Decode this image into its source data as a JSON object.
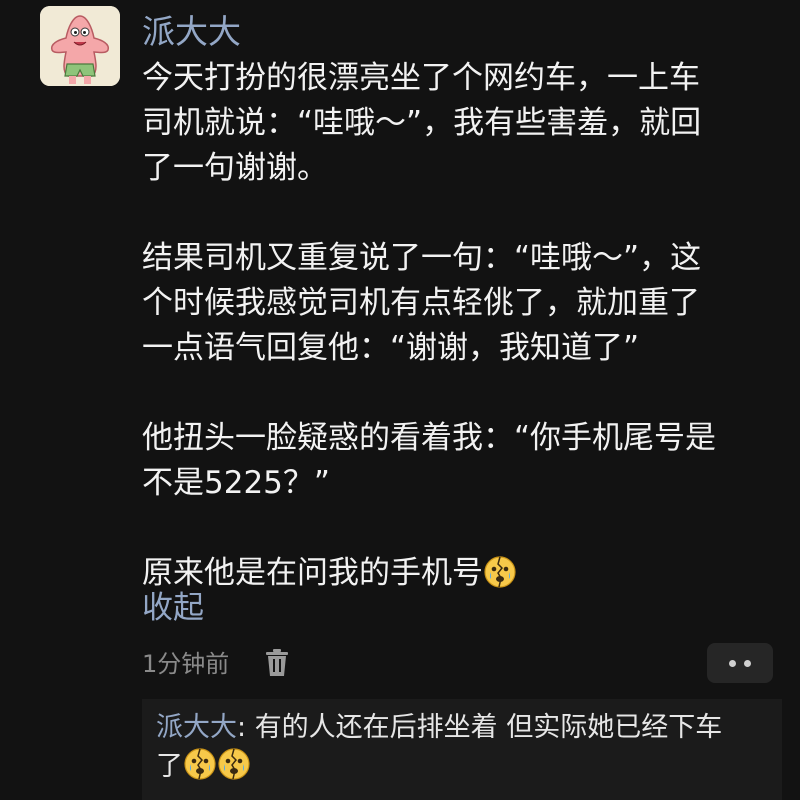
{
  "comment": {
    "author": "派大大",
    "lines": [
      "今天打扮的很漂亮坐了个网约车，一上车",
      "司机就说：“哇哦～”，我有些害羞，就回",
      "了一句谢谢。",
      "",
      "结果司机又重复说了一句：“哇哦～”，这",
      "个时候我感觉司机有点轻佻了，就加重了",
      "一点语气回复他：“谢谢，我知道了”",
      "",
      "他扭头一脸疑惑的看着我：“你手机尾号是",
      "不是5225？”",
      "",
      "原来他是在问我的手机号"
    ],
    "collapse_label": "收起",
    "time": "1分钟前"
  },
  "reply": {
    "author": "派大大",
    "separator": ": ",
    "line1": "有的人还在后排坐着 但实际她已经下车",
    "line2": "了"
  },
  "icons": {
    "avatar": "patrick-star-avatar",
    "emoji": "cracked-crying-face-emoji",
    "delete": "trash-icon",
    "more": "more-dots-icon"
  },
  "colors": {
    "background": "#121212",
    "link": "#93a7c6",
    "text": "#f2f2f2",
    "muted": "#8a8a8a",
    "reply_background": "#1b1b1b"
  }
}
